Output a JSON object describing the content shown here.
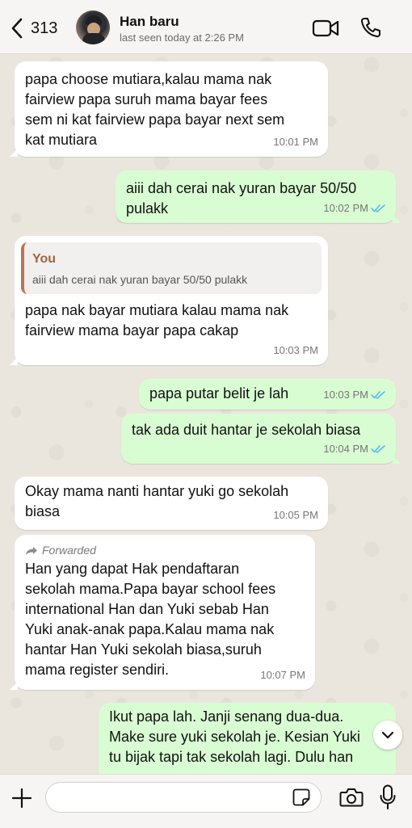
{
  "header": {
    "back_count": "313",
    "contact_name": "Han baru",
    "last_seen": "last seen today at 2:26 PM"
  },
  "messages": [
    {
      "direction": "in",
      "text": "papa choose mutiara,kalau mama nak\nfairview papa suruh mama bayar fees\nsem ni kat fairview papa bayar next sem\nkat mutiara",
      "time": "10:01 PM"
    },
    {
      "direction": "out",
      "text": "aiii dah cerai nak yuran bayar 50/50\npulakk",
      "time": "10:02 PM",
      "status": "read"
    },
    {
      "direction": "in",
      "reply_author": "You",
      "reply_text": "aiii dah cerai nak yuran bayar 50/50 pulakk",
      "text": "papa nak bayar mutiara kalau mama nak\nfairview mama bayar papa cakap",
      "time": "10:03 PM"
    },
    {
      "direction": "out",
      "text": "papa putar belit je lah",
      "time": "10:03 PM",
      "status": "read"
    },
    {
      "direction": "out",
      "text": "tak ada duit hantar je sekolah biasa",
      "time": "10:04 PM",
      "status": "read"
    },
    {
      "direction": "in",
      "text": "Okay mama nanti hantar yuki go sekolah\nbiasa",
      "time": "10:05 PM"
    },
    {
      "direction": "in",
      "forwarded_label": "Forwarded",
      "text": "Han yang dapat Hak pendaftaran\nsekolah mama.Papa bayar school fees\ninternational Han dan Yuki sebab Han\nYuki anak-anak papa.Kalau mama nak\nhantar Han Yuki sekolah biasa,suruh\nmama register sendiri.",
      "time": "10:07 PM"
    },
    {
      "direction": "out",
      "text": "Ikut papa lah. Janji senang dua-dua.\nMake sure yuki sekolah je. Kesian Yuki\ntu bijak tapi tak sekolah lagi. Dulu han",
      "time": ""
    }
  ],
  "input": {
    "value": "",
    "placeholder": ""
  },
  "colors": {
    "incoming": "#ffffff",
    "outgoing": "#d9fdd3",
    "read_tick": "#53bdeb",
    "reply_author": "#a4633f"
  }
}
